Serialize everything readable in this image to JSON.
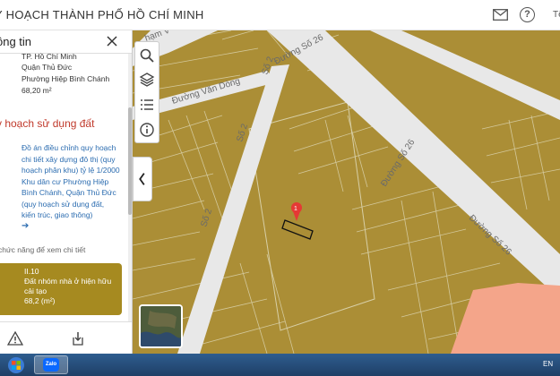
{
  "header": {
    "title": "Y HOẠCH THÀNH PHỐ HỒ CHÍ MINH",
    "more_label": "Tê"
  },
  "panel": {
    "title": "ông tin",
    "address_lines": [
      "TP. Hồ Chí Minh",
      "Quận Thủ Đức",
      "Phường Hiệp Bình Chánh",
      "68,20 m²"
    ],
    "section_title": "y hoạch sử dụng đất",
    "document_link": "Đồ án điều chỉnh quy hoạch chi tiết xây dựng đô thị (quy hoạch phân khu) tỷ lệ 1/2000 Khu dân cư Phường Hiệp Bình Chánh, Quận Thủ Đức (quy hoạch sử dụng đất, kiến trúc, giao thông)",
    "arrow": "➔",
    "hint": "chức năng để xem chi tiết",
    "land_card": {
      "code": "II.10",
      "name_line1": "Đất nhóm nhà ở hiện hữu",
      "name_line2": "cải tạo",
      "area": "68,2 (m²)"
    }
  },
  "map": {
    "road_labels": [
      "Đường Số 26",
      "Đường Số 26",
      "Đường Số 26",
      "Số 2",
      "Số 2",
      "Số 2",
      "Đường Văn Dòng",
      "hạm V"
    ],
    "marker_label": "1",
    "land_color": "#ab8e36",
    "road_color": "#e8e8e8",
    "commercial_color": "#f4a58a"
  },
  "taskbar": {
    "app_label": "Zalo",
    "lang": "EN"
  }
}
